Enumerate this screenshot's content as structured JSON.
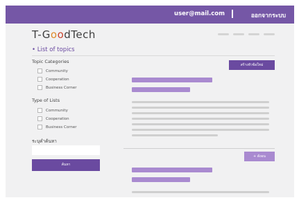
{
  "header": {
    "user_email": "user@mail.com",
    "logout_label": "ออกจากระบบ"
  },
  "brand": {
    "logo_parts": [
      "T-G",
      "o",
      "o",
      "dTech"
    ]
  },
  "page": {
    "section_title": "• List of topics",
    "create_button_label": "สร้างหัวข้อใหม่"
  },
  "sidebar": {
    "topic_categories": {
      "title": "Topic Categories",
      "items": [
        "Community",
        "Cooperation",
        "Business Corner"
      ]
    },
    "type_of_lists": {
      "title": "Type of Lists",
      "items": [
        "Community",
        "Cooperation",
        "Business Corner"
      ]
    },
    "search": {
      "label": "ระบุคำค้นหา",
      "placeholder": "",
      "button_label": "ค้นหา"
    }
  },
  "content": {
    "more_button_label": "+ ดังอน"
  },
  "colors": {
    "primary": "#7557a6",
    "accent_bar": "#a98ad0",
    "background": "#f1f1f2"
  }
}
